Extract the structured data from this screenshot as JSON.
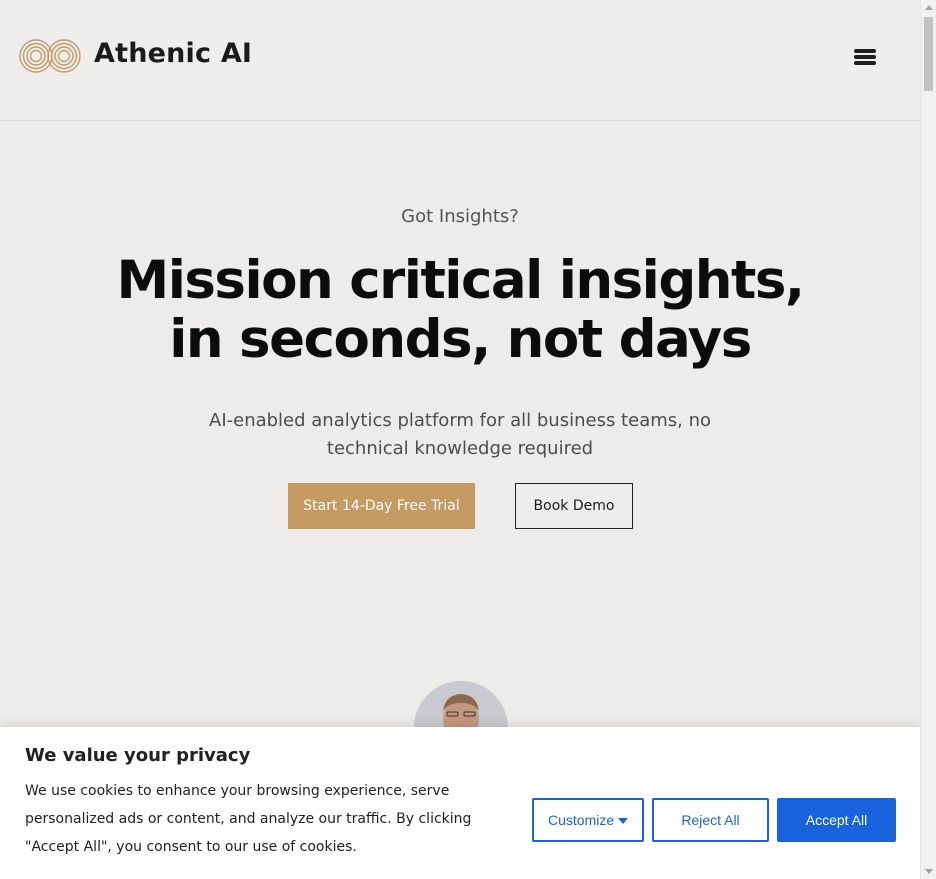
{
  "header": {
    "brand": "Athenic AI",
    "logo_icon": "infinity-rings-logo",
    "menu_icon": "hamburger-menu-icon"
  },
  "hero": {
    "eyebrow": "Got Insights?",
    "headline_line1": "Mission critical insights,",
    "headline_line2": "in seconds, not days",
    "subhead": "AI-enabled analytics platform for all business teams, no technical knowledge required",
    "primary_cta": "Start 14-Day Free Trial",
    "secondary_cta": "Book Demo"
  },
  "cookie_banner": {
    "title": "We value your privacy",
    "text": "We use cookies to enhance your browsing experience, serve personalized ads or content, and analyze our traffic. By clicking \"Accept All\", you consent to our use of cookies.",
    "customize_label": "Customize",
    "reject_label": "Reject All",
    "accept_label": "Accept All"
  },
  "colors": {
    "brand_gold": "#c49a62",
    "consent_blue": "#1863dc",
    "page_bg": "#edecea"
  }
}
